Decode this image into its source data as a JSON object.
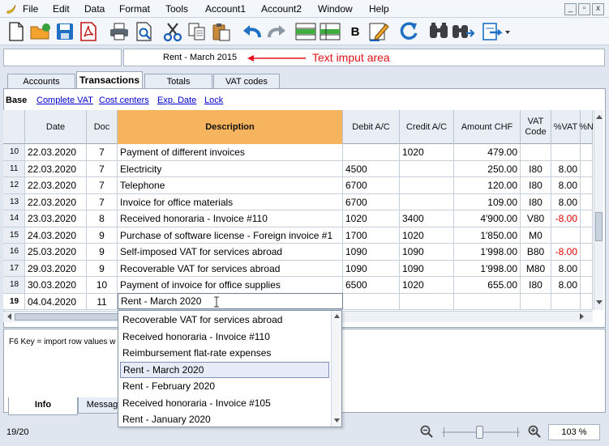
{
  "menubar": {
    "items": [
      "File",
      "Edit",
      "Data",
      "Format",
      "Tools",
      "Account1",
      "Account2",
      "Window",
      "Help"
    ],
    "window_buttons": [
      "_",
      "▫",
      "x"
    ]
  },
  "toolbar": {
    "icons": [
      "new-file-icon",
      "open-folder-icon",
      "save-icon",
      "pdf-icon",
      "print-icon",
      "print-preview-icon",
      "cut-icon",
      "copy-icon",
      "paste-icon",
      "undo-icon",
      "redo-icon",
      "insert-row-icon",
      "delete-row-icon",
      "bold-icon",
      "edit-pen-icon",
      "refresh-icon",
      "find-icon",
      "replace-icon",
      "export-icon"
    ],
    "bold_label": "B"
  },
  "input_area": {
    "value": "Rent - March 2015",
    "annotation": "Text imput area",
    "annotation_color": "#e0141a"
  },
  "tabs": [
    "Accounts",
    "Transactions",
    "Totals",
    "VAT codes"
  ],
  "active_tab": "Transactions",
  "views": [
    "Base",
    "Complete VAT",
    "Cost centers",
    "Exp. Date",
    "Lock"
  ],
  "active_view": "Base",
  "table": {
    "columns": [
      "",
      "Date",
      "Doc",
      "Description",
      "Debit A/C",
      "Credit A/C",
      "Amount CHF",
      "VAT Code",
      "%VAT",
      "%N"
    ],
    "rows": [
      {
        "n": "10",
        "date": "22.03.2020",
        "doc": "7",
        "desc": "Payment of different invoices",
        "debit": "",
        "credit": "1020",
        "amount": "479.00",
        "vat": "",
        "pct": ""
      },
      {
        "n": "11",
        "date": "22.03.2020",
        "doc": "7",
        "desc": "Electricity",
        "debit": "4500",
        "credit": "",
        "amount": "250.00",
        "vat": "I80",
        "pct": "8.00"
      },
      {
        "n": "12",
        "date": "22.03.2020",
        "doc": "7",
        "desc": "Telephone",
        "debit": "6700",
        "credit": "",
        "amount": "120.00",
        "vat": "I80",
        "pct": "8.00"
      },
      {
        "n": "13",
        "date": "22.03.2020",
        "doc": "7",
        "desc": "Invoice for office materials",
        "debit": "6700",
        "credit": "",
        "amount": "109.00",
        "vat": "I80",
        "pct": "8.00"
      },
      {
        "n": "14",
        "date": "23.03.2020",
        "doc": "8",
        "desc": "Received honoraria - Invoice #110",
        "debit": "1020",
        "credit": "3400",
        "amount": "4'900.00",
        "vat": "V80",
        "pct": "-8.00"
      },
      {
        "n": "15",
        "date": "24.03.2020",
        "doc": "9",
        "desc": "Purchase of software license - Foreign invoice #1",
        "debit": "1700",
        "credit": "1020",
        "amount": "1'850.00",
        "vat": "M0",
        "pct": ""
      },
      {
        "n": "16",
        "date": "25.03.2020",
        "doc": "9",
        "desc": "Self-imposed VAT for services abroad",
        "debit": "1090",
        "credit": "1090",
        "amount": "1'998.00",
        "vat": "B80",
        "pct": "-8.00"
      },
      {
        "n": "17",
        "date": "29.03.2020",
        "doc": "9",
        "desc": "Recoverable VAT for services abroad",
        "debit": "1090",
        "credit": "1090",
        "amount": "1'998.00",
        "vat": "M80",
        "pct": "8.00"
      },
      {
        "n": "18",
        "date": "30.03.2020",
        "doc": "10",
        "desc": "Payment of invoice for office supplies",
        "debit": "6500",
        "credit": "1020",
        "amount": "655.00",
        "vat": "I80",
        "pct": "8.00"
      }
    ],
    "current_row": {
      "n": "19",
      "date": "04.04.2020",
      "doc": "11",
      "desc": "Rent - March 2020"
    }
  },
  "autocomplete": {
    "options": [
      "Recoverable VAT for services abroad",
      "Received honoraria - Invoice #110",
      "Reimbursement flat-rate expenses",
      "Rent - March 2020",
      "Rent - February 2020",
      "Received honoraria - Invoice #105",
      "Rent - January 2020"
    ],
    "selected": "Rent - March 2020"
  },
  "info_panel": {
    "text": "F6 Key = import row values w",
    "tabs": [
      "Info",
      "Messag"
    ],
    "active_tab": "Info"
  },
  "status": {
    "count": "19/20",
    "zoom": "103 %",
    "zoom_level_percent": 103
  },
  "colors": {
    "header_desc": "#f7b45e",
    "negative": "#e00000",
    "link": "#0000d0"
  }
}
